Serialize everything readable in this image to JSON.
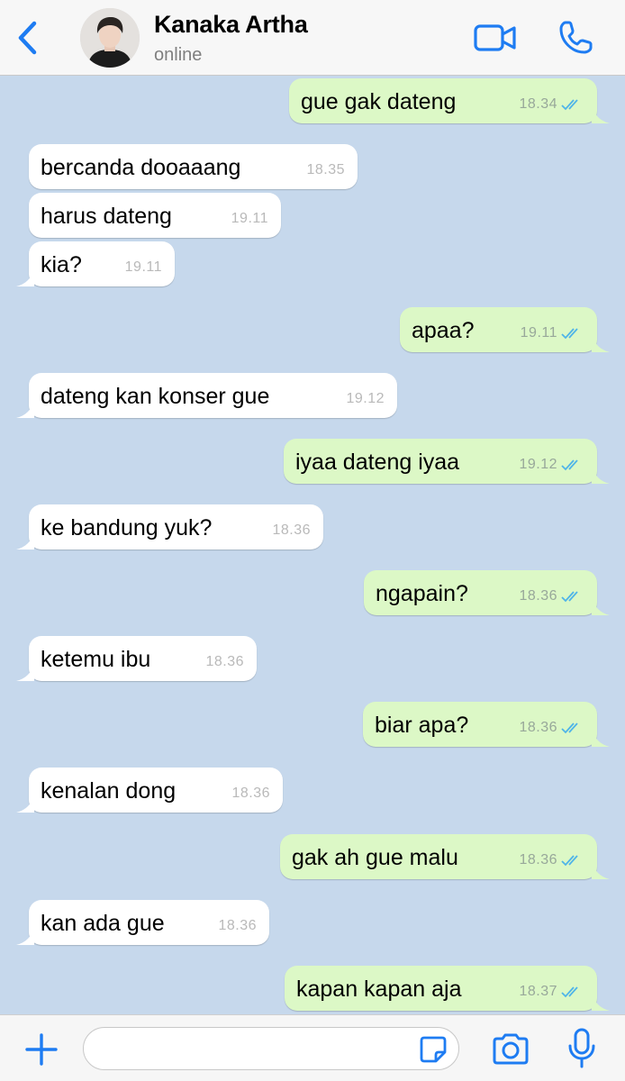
{
  "header": {
    "contact_name": "Kanaka Artha",
    "status": "online"
  },
  "colors": {
    "accent": "#1e7cf2",
    "chat_background": "#c6d8ec",
    "incoming_bubble": "#ffffff",
    "outgoing_bubble": "#dcf8c6",
    "read_ticks": "#4fb4e8"
  },
  "icons": {
    "back": "chevron-left-icon",
    "video": "video-camera-icon",
    "call": "phone-icon",
    "attach": "plus-icon",
    "sticker": "sticker-icon",
    "camera": "camera-icon",
    "mic": "microphone-icon"
  },
  "messages": [
    {
      "direction": "out",
      "text": "gue gak dateng",
      "time": "18.34",
      "read": true
    },
    {
      "direction": "in",
      "text": "bercanda dooaaang",
      "time": "18.35"
    },
    {
      "direction": "in",
      "text": "harus dateng",
      "time": "19.11"
    },
    {
      "direction": "in",
      "text": "kia?",
      "time": "19.11"
    },
    {
      "direction": "out",
      "text": "apaa?",
      "time": "19.11",
      "read": true
    },
    {
      "direction": "in",
      "text": "dateng kan konser gue",
      "time": "19.12"
    },
    {
      "direction": "out",
      "text": "iyaa dateng iyaa",
      "time": "19.12",
      "read": true
    },
    {
      "direction": "in",
      "text": "ke bandung yuk?",
      "time": "18.36"
    },
    {
      "direction": "out",
      "text": "ngapain?",
      "time": "18.36",
      "read": true
    },
    {
      "direction": "in",
      "text": "ketemu ibu",
      "time": "18.36"
    },
    {
      "direction": "out",
      "text": "biar apa?",
      "time": "18.36",
      "read": true
    },
    {
      "direction": "in",
      "text": "kenalan dong",
      "time": "18.36"
    },
    {
      "direction": "out",
      "text": "gak ah gue malu",
      "time": "18.36",
      "read": true
    },
    {
      "direction": "in",
      "text": "kan ada gue",
      "time": "18.36"
    },
    {
      "direction": "out",
      "text": "kapan kapan aja",
      "time": "18.37",
      "read": true
    }
  ],
  "composer": {
    "placeholder": "",
    "value": ""
  }
}
